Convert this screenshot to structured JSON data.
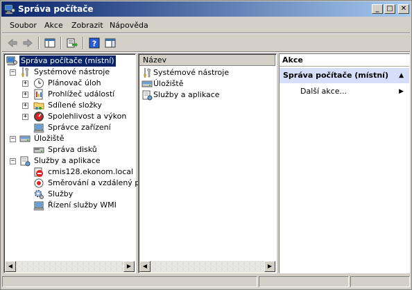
{
  "window": {
    "title": "Správa počítače",
    "buttons": {
      "minimize": "_",
      "maximize": "□",
      "close": "✕"
    }
  },
  "menubar": {
    "items": [
      "Soubor",
      "Akce",
      "Zobrazit",
      "Nápověda"
    ]
  },
  "tree": {
    "root": "Správa počítače (místní)",
    "items": [
      {
        "label": "Systémové nástroje",
        "icon": "tools-icon"
      },
      {
        "label": "Plánovač úloh",
        "icon": "clock-icon"
      },
      {
        "label": "Prohlížeč událostí",
        "icon": "event-viewer-icon"
      },
      {
        "label": "Sdílené složky",
        "icon": "shared-folder-icon"
      },
      {
        "label": "Spolehlivost a výkon",
        "icon": "performance-icon"
      },
      {
        "label": "Správce zařízení",
        "icon": "device-manager-icon"
      },
      {
        "label": "Úložiště",
        "icon": "storage-icon"
      },
      {
        "label": "Správa disků",
        "icon": "disk-icon"
      },
      {
        "label": "Služby a aplikace",
        "icon": "services-apps-icon"
      },
      {
        "label": "cmis128.ekonom.local",
        "icon": "no-entry-icon"
      },
      {
        "label": "Směrování a vzdálený přís",
        "icon": "routing-icon"
      },
      {
        "label": "Služby",
        "icon": "gear-icon"
      },
      {
        "label": "Řízení služby WMI",
        "icon": "wmi-icon"
      }
    ]
  },
  "list": {
    "column": "Název",
    "items": [
      {
        "label": "Systémové nástroje",
        "icon": "tools-icon"
      },
      {
        "label": "Úložiště",
        "icon": "storage-icon"
      },
      {
        "label": "Služby a aplikace",
        "icon": "services-apps-icon"
      }
    ]
  },
  "actions": {
    "header": "Akce",
    "section": "Správa počítače (místní)",
    "more": "Další akce..."
  },
  "colors": {
    "titlebar": "#0a246a",
    "selection": "#0a246a",
    "actions_band": "#d6dff7"
  }
}
